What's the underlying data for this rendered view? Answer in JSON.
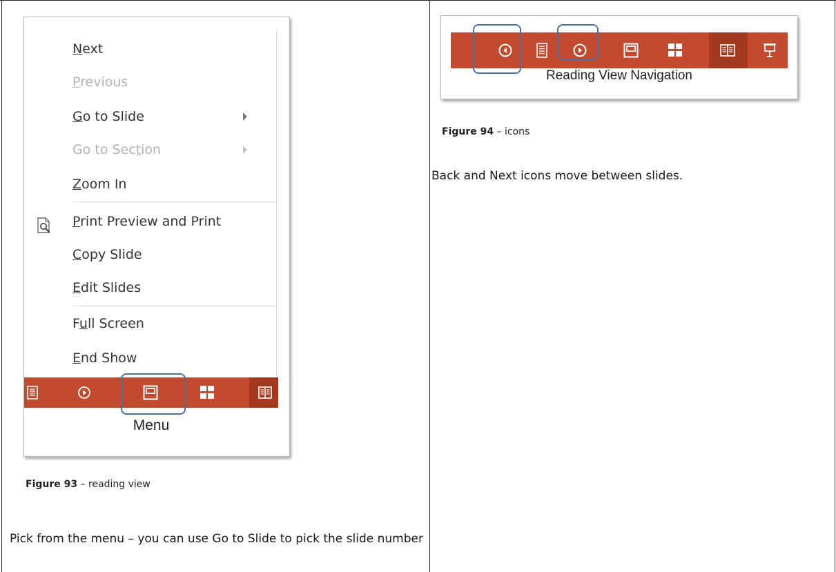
{
  "figure93": {
    "menu_items": [
      {
        "label": "Next",
        "accel": "N",
        "enabled": true
      },
      {
        "label": "Previous",
        "accel": "P",
        "enabled": false
      },
      {
        "label": "Go to Slide",
        "accel": "G",
        "enabled": true,
        "submenu": true
      },
      {
        "label": "Go to Section",
        "accel": "t",
        "enabled": false,
        "submenu": true
      },
      {
        "label": "Zoom In",
        "accel": "Z",
        "enabled": true
      },
      {
        "label": "Print Preview and Print",
        "accel": "P",
        "enabled": true,
        "icon": "print-preview-icon"
      },
      {
        "label": "Copy Slide",
        "accel": "C",
        "enabled": true
      },
      {
        "label": "Edit Slides",
        "accel": "E",
        "enabled": true
      },
      {
        "label": "Full Screen",
        "accel": "u",
        "enabled": true
      },
      {
        "label": "End Show",
        "accel": "E",
        "enabled": true
      }
    ],
    "toolbar_icons": [
      "notes-icon",
      "next-circle-icon",
      "slide-view-icon",
      "grid-icon",
      "reading-view-icon"
    ],
    "toolbar_caption": "Menu",
    "caption_bold": "Figure 93",
    "caption_rest": " – reading view",
    "description": "Pick from the menu – you can use Go to Slide to pick the slide number"
  },
  "figure94": {
    "toolbar_icons": [
      "back-circle-icon",
      "notes-icon",
      "next-circle-icon",
      "slide-view-icon",
      "grid-icon",
      "reading-view-icon",
      "slideshow-icon"
    ],
    "toolbar_caption": "Reading View Navigation",
    "caption_bold": "Figure 94",
    "caption_rest": " – icons",
    "description": "Back and Next icons move between slides."
  },
  "colors": {
    "toolbar_red": "#c24a2e",
    "toolbar_dark": "#a3391f",
    "highlight_blue": "#4a6fa3"
  }
}
